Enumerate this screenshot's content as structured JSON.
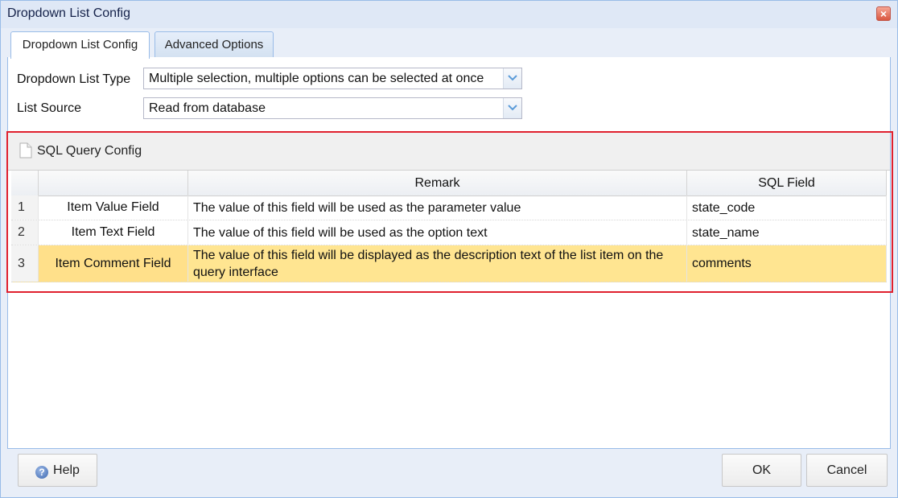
{
  "window": {
    "title": "Dropdown List Config"
  },
  "tabs": [
    {
      "label": "Dropdown List Config",
      "active": true
    },
    {
      "label": "Advanced Options",
      "active": false
    }
  ],
  "form": {
    "list_type_label": "Dropdown List Type",
    "list_type_value": "Multiple selection, multiple options can be selected at once",
    "list_source_label": "List Source",
    "list_source_value": "Read from database"
  },
  "sql_config": {
    "title": "SQL Query Config",
    "columns": [
      "",
      "",
      "Remark",
      "SQL Field"
    ],
    "rows": [
      {
        "num": "1",
        "name": "Item Value Field",
        "remark": "The value of this field will be used as the parameter value",
        "field": "state_code"
      },
      {
        "num": "2",
        "name": "Item Text Field",
        "remark": "The value of this field will be used as the option text",
        "field": "state_name"
      },
      {
        "num": "3",
        "name": "Item Comment Field",
        "remark": "The value of this field will be displayed as the description text of the list item on the query interface",
        "field": "comments"
      }
    ]
  },
  "footer": {
    "help_label": "Help",
    "ok_label": "OK",
    "cancel_label": "Cancel"
  },
  "colors": {
    "selected_row": "#ffe591",
    "highlight_border": "#e0202e",
    "accent": "#99bce8"
  }
}
